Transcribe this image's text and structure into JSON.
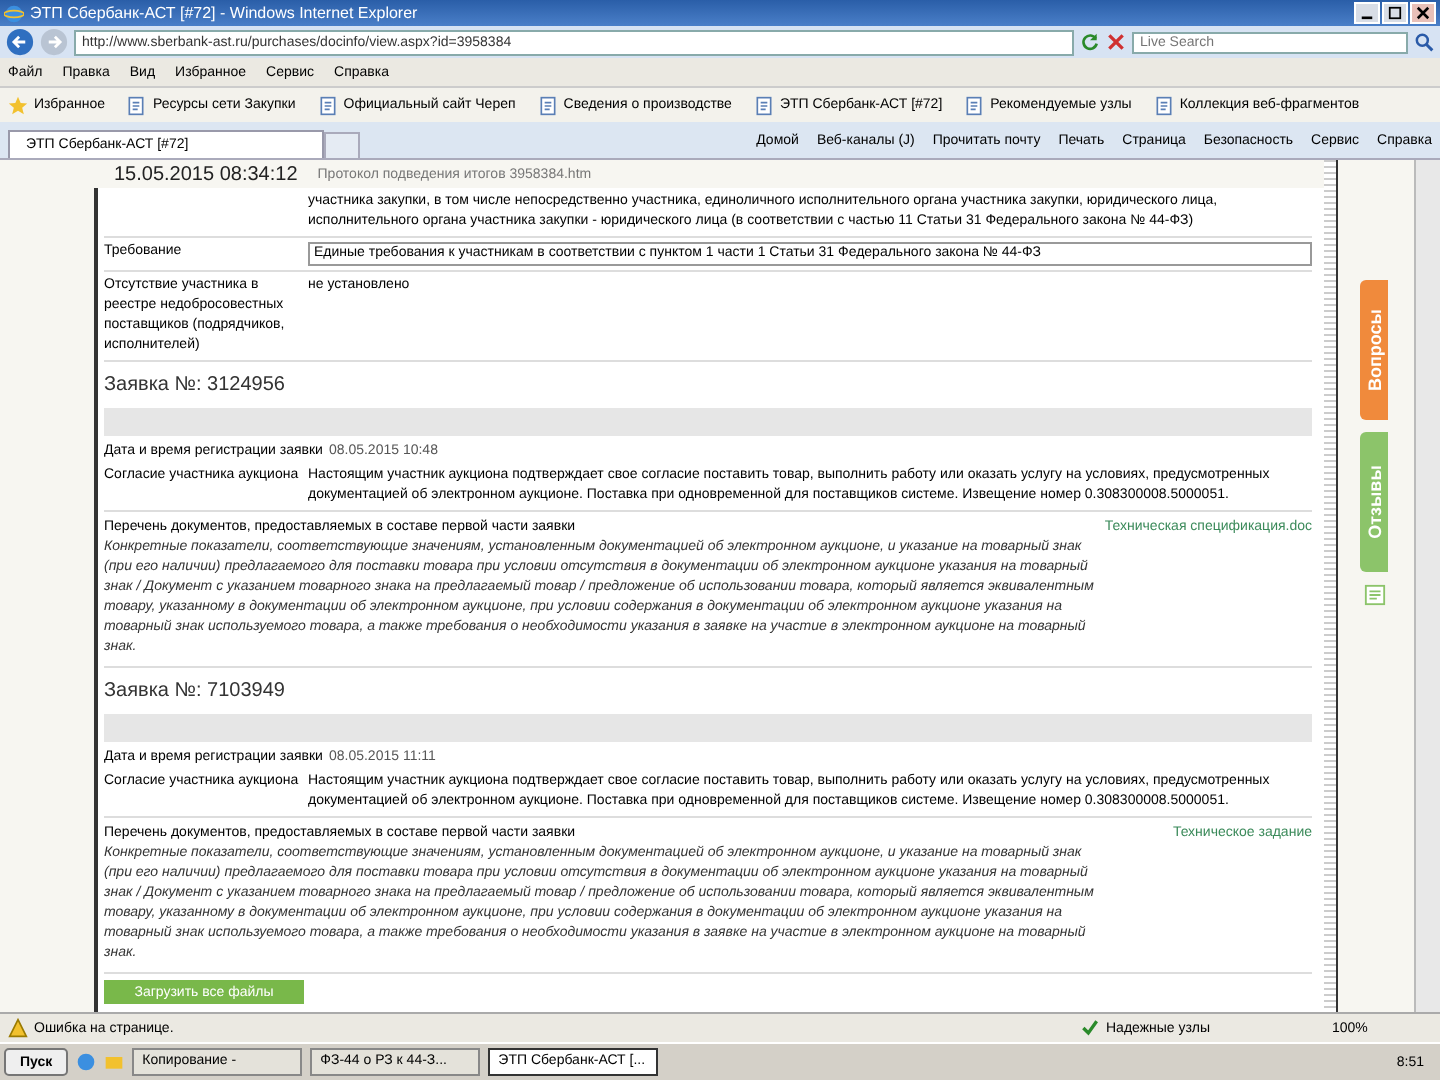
{
  "window": {
    "title": "ЭТП Сбербанк-АСТ [#72] - Windows Internet Explorer"
  },
  "address_bar": {
    "url": "http://www.sberbank-ast.ru/purchases/docinfo/view.aspx?id=3958384",
    "search_placeholder": "Live Search"
  },
  "menu": [
    "Файл",
    "Правка",
    "Вид",
    "Избранное",
    "Сервис",
    "Справка"
  ],
  "favorites_bar": [
    {
      "label": "Избранное"
    },
    {
      "label": "Ресурсы сети Закупки"
    },
    {
      "label": "Официальный сайт Череп"
    },
    {
      "label": "Сведения о производстве"
    },
    {
      "label": "ЭТП Сбербанк-АСТ [#72]"
    },
    {
      "label": "Рекомендуемые узлы"
    },
    {
      "label": "Коллекция веб-фрагментов"
    }
  ],
  "tabs": [
    {
      "label": "ЭТП Сбербанк-АСТ [#72]",
      "selected": true
    }
  ],
  "command_bar": [
    "Домой",
    "Веб-каналы (J)",
    "Прочитать почту",
    "Печать",
    "Страница",
    "Безопасность",
    "Сервис",
    "Справка"
  ],
  "page_header": {
    "date": "15.05.2015 08:34:12",
    "file": "Протокол подведения итогов 3958384.htm"
  },
  "requirements": [
    {
      "value": "участника закупки, в том числе непосредственно участника, единоличного исполнительного органа участника закупки, юридического лица, исполнительного органа участника закупки - юридического лица (в соответствии с частью 11 Статьи 31 Федерального закона № 44-ФЗ)",
      "boxed": false
    },
    {
      "label": "Требование",
      "value": "Единые требования к участникам в соответствии с пунктом 1 части 1 Статьи 31 Федерального закона № 44-ФЗ",
      "boxed": true
    },
    {
      "label": "Отсутствие участника в реестре недобросовестных поставщиков (подрядчиков, исполнителей)",
      "value": "не установлено",
      "boxed": false
    }
  ],
  "applications": [
    {
      "number": "Заявка №: 3124956",
      "registered_label": "Дата и время регистрации заявки",
      "registered": "08.05.2015 10:48",
      "consent_label": "Согласие участника аукциона",
      "consent": "Настоящим участник аукциона подтверждает свое согласие поставить товар, выполнить работу или оказать услугу на условиях, предусмотренных документацией об электронном аукционе. Поставка при одновременной для поставщиков системе. Извещение номер 0.308300008.5000051.",
      "documents_label": "Перечень документов, предоставляемых в составе первой части заявки",
      "file_link": "Техническая спецификация.doc",
      "documents": "Конкретные показатели, соответствующие значениям, установленным документацией об электронном аукционе, и указание на товарный знак (при его наличии) предлагаемого для поставки товара при условии отсутствия в документации об электронном аукционе указания на товарный знак / Документ с указанием товарного знака на предлагаемый товар / предложение об использовании товара, который является эквивалентным товару, указанному в документации об электронном аукционе, при условии содержания в документации об электронном аукционе указания на товарный знак используемого товара, а также требования о необходимости указания в заявке на участие в электронном аукционе на товарный знак."
    },
    {
      "number": "Заявка №: 7103949",
      "registered_label": "Дата и время регистрации заявки",
      "registered": "08.05.2015 11:11",
      "consent_label": "Согласие участника аукциона",
      "consent": "Настоящим участник аукциона подтверждает свое согласие поставить товар, выполнить работу или оказать услугу на условиях, предусмотренных документацией об электронном аукционе. Поставка при одновременной для поставщиков системе. Извещение номер 0.308300008.5000051.",
      "documents_label": "Перечень документов, предоставляемых в составе первой части заявки",
      "file_link": "Техническое задание",
      "documents": "Конкретные показатели, соответствующие значениям, установленным документацией об электронном аукционе, и указание на товарный знак (при его наличии) предлагаемого для поставки товара при условии отсутствия в документации об электронном аукционе указания на товарный знак / Документ с указанием товарного знака на предлагаемый товар / предложение об использовании товара, который является эквивалентным товару, указанному в документации об электронном аукционе, при условии содержания в документации об электронном аукционе указания на товарный знак используемого товара, а также требования о необходимости указания в заявке на участие в электронном аукционе на товарный знак."
    }
  ],
  "download_button": "Загрузить все файлы",
  "side_tabs": [
    {
      "label": "Вопросы",
      "color": "#f08a3c"
    },
    {
      "label": "Отзывы",
      "color": "#8cc46a"
    }
  ],
  "status_bar": {
    "message": "Ошибка на странице.",
    "zone": "Надежные узлы",
    "zoom": "100%"
  },
  "taskbar": {
    "start": "Пуск",
    "items": [
      {
        "label": "Копирование - ",
        "selected": false
      },
      {
        "label": "ФЗ-44 о РЗ к 44-З...",
        "selected": false
      },
      {
        "label": "ЭТП Сбербанк-АСТ [...",
        "selected": true
      }
    ],
    "clock": "8:51"
  }
}
